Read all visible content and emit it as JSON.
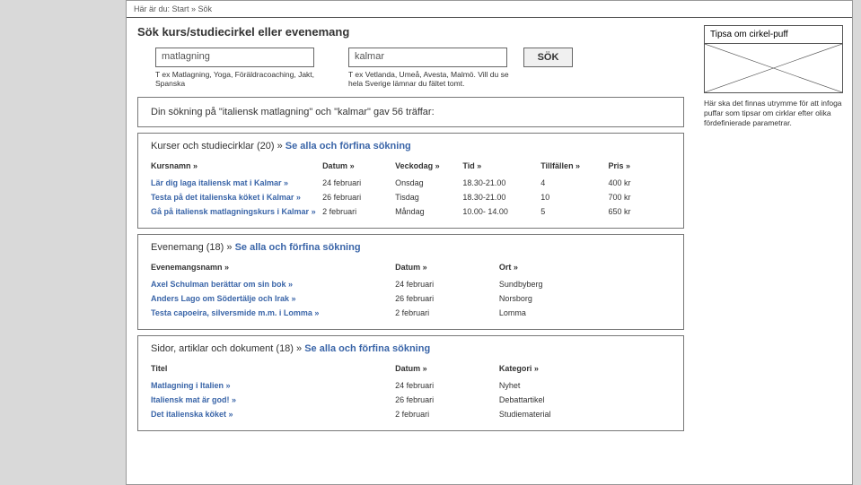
{
  "breadcrumb": "Här är du:  Start » Sök",
  "search": {
    "title": "Sök kurs/studiecirkel eller evenemang",
    "query_value": "matlagning",
    "query_hint": "T ex Matlagning, Yoga, Föräldracoaching, Jakt, Spanska",
    "location_value": "kalmar",
    "location_hint": "T ex Vetlanda, Umeå, Avesta, Malmö. Vill du se hela Sverige lämnar du fältet tomt.",
    "button": "SÖK"
  },
  "summary": "Din sökning på \"italiensk matlagning\" och \"kalmar\" gav 56 träffar:",
  "courses": {
    "heading_prefix": "Kurser och studiecirklar (20) »",
    "heading_link": "Se alla och förfina sökning",
    "cols": {
      "name": "Kursnamn »",
      "date": "Datum »",
      "day": "Veckodag »",
      "time": "Tid »",
      "occ": "Tillfällen »",
      "price": "Pris »"
    },
    "rows": [
      {
        "name": "Lär dig laga italiensk mat i Kalmar »",
        "date": "24 februari",
        "day": "Onsdag",
        "time": "18.30-21.00",
        "occ": "4",
        "price": "400 kr"
      },
      {
        "name": "Testa på det italienska köket i Kalmar »",
        "date": "26 februari",
        "day": "Tisdag",
        "time": "18.30-21.00",
        "occ": "10",
        "price": "700 kr"
      },
      {
        "name": "Gå på italiensk matlagningskurs i Kalmar »",
        "date": "2 februari",
        "day": "Måndag",
        "time": "10.00- 14.00",
        "occ": "5",
        "price": "650 kr"
      }
    ]
  },
  "events": {
    "heading_prefix": "Evenemang (18) »",
    "heading_link": "Se alla och förfina sökning",
    "cols": {
      "name": "Evenemangsnamn »",
      "date": "Datum »",
      "place": "Ort »"
    },
    "rows": [
      {
        "name": "Axel Schulman berättar om sin bok »",
        "date": "24 februari",
        "place": "Sundbyberg"
      },
      {
        "name": "Anders Lago om Södertälje och Irak »",
        "date": "26 februari",
        "place": "Norsborg"
      },
      {
        "name": "Testa capoeira, silversmide m.m. i Lomma »",
        "date": "2 februari",
        "place": "Lomma"
      }
    ]
  },
  "docs": {
    "heading_prefix": "Sidor, artiklar och dokument (18) »",
    "heading_link": "Se alla och förfina sökning",
    "cols": {
      "title": "Titel",
      "date": "Datum »",
      "cat": "Kategori »"
    },
    "rows": [
      {
        "title": "Matlagning i Italien »",
        "date": "24 februari",
        "cat": "Nyhet"
      },
      {
        "title": "Italiensk mat är god! »",
        "date": "26 februari",
        "cat": "Debattartikel"
      },
      {
        "title": "Det italienska köket »",
        "date": "2 februari",
        "cat": "Studiematerial"
      }
    ]
  },
  "sidebar": {
    "promo_title": "Tipsa om cirkel-puff",
    "note": "Här ska det finnas utrymme för att infoga puffar som tipsar om cirklar efter olika fördefinierade parametrar."
  }
}
